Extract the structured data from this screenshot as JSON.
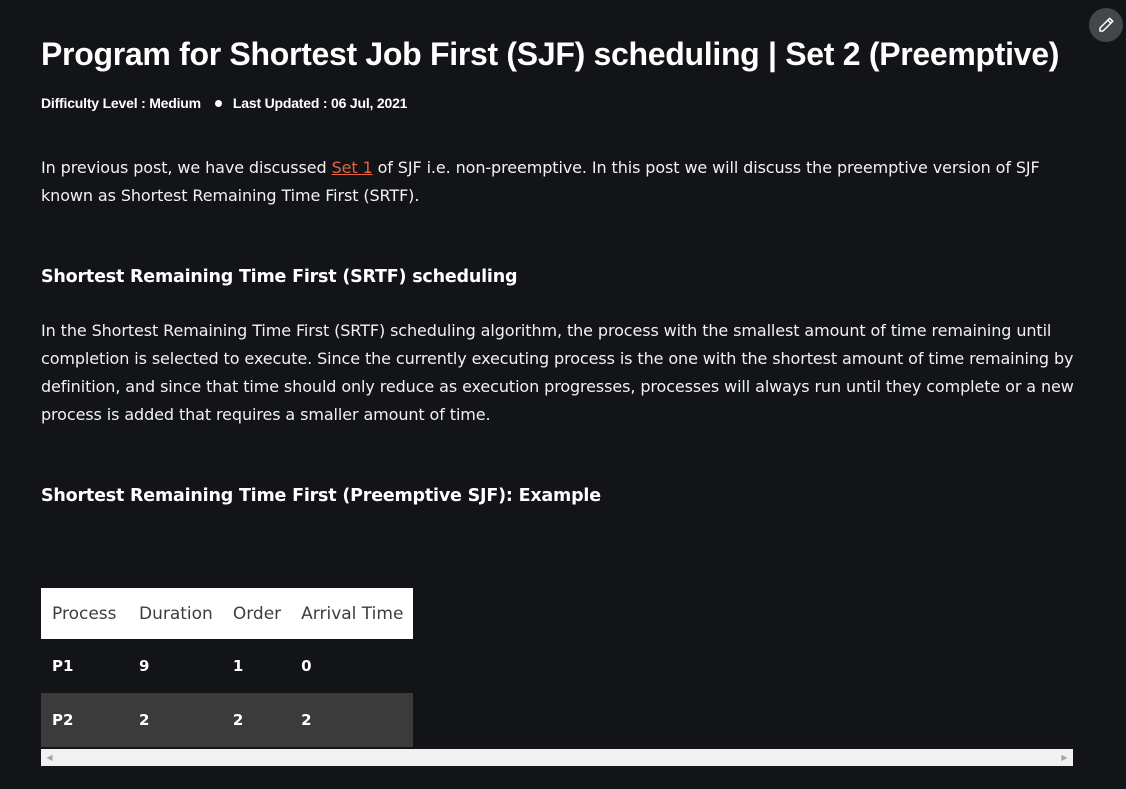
{
  "article": {
    "title": "Program for Shortest Job First (SJF) scheduling | Set 2 (Preemptive)",
    "difficulty": "Difficulty Level : Medium",
    "last_updated": "Last Updated : 06 Jul, 2021",
    "intro": {
      "before_link": "In previous post, we have discussed ",
      "link_text": "Set 1",
      "after_link": " of SJF i.e. non-preemptive. In this post we will discuss the preemptive version of SJF known as Shortest Remaining Time First (SRTF)."
    },
    "section1": {
      "heading": "Shortest Remaining Time First (SRTF) scheduling",
      "body": "In the Shortest Remaining Time First (SRTF) scheduling algorithm, the process with the smallest amount of time remaining until completion is selected to execute. Since the currently executing process is the one with the shortest amount of time remaining by definition, and since that time should only reduce as execution progresses, processes will always run until they complete or a new process is added that requires a smaller amount of time."
    },
    "section2": {
      "heading": "Shortest Remaining Time First (Preemptive SJF): Example"
    }
  },
  "table": {
    "headers": [
      "Process",
      "Duration",
      "Order",
      "Arrival Time"
    ],
    "rows": [
      [
        "P1",
        "9",
        "1",
        "0"
      ],
      [
        "P2",
        "2",
        "2",
        "2"
      ]
    ]
  },
  "icons": {
    "edit": "pencil-icon",
    "scroll_left": "scroll-left-arrow-icon",
    "scroll_right": "scroll-right-arrow-icon"
  },
  "colors": {
    "background": "#131417",
    "link": "#e0633e",
    "table_header_bg": "#ffffff",
    "table_alt_row_bg": "#3b3b3b"
  }
}
